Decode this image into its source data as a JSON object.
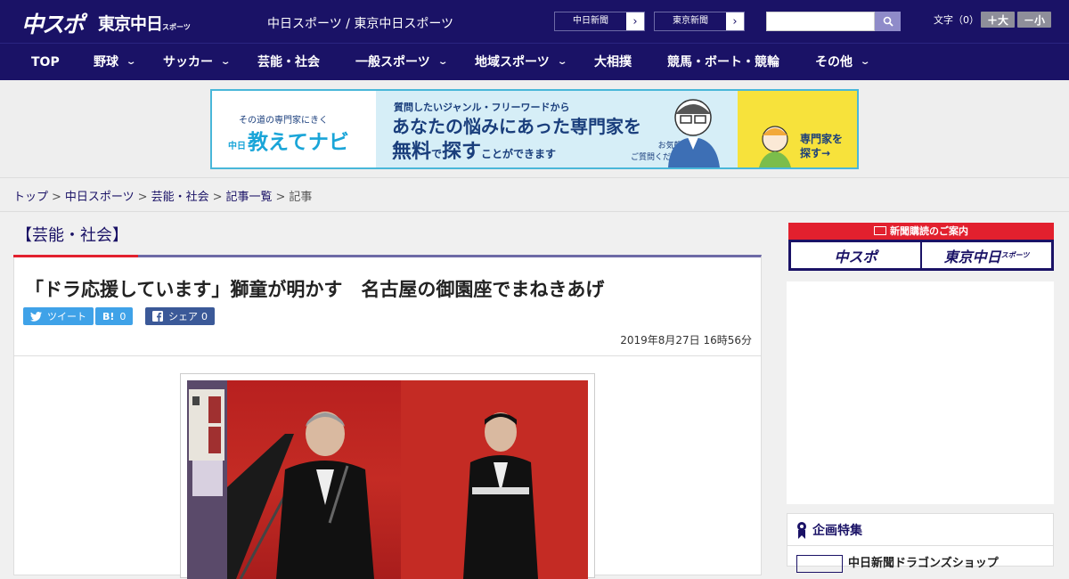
{
  "header": {
    "logo_chuspo": "中スポ",
    "logo_tokyo": "東京中日",
    "logo_tokyo_small": "スポーツ",
    "site_title": "中日スポーツ / 東京中日スポーツ",
    "paper_buttons": [
      "中日新聞",
      "東京新聞"
    ],
    "font_label": "文字（0）",
    "font_bigger": "＋大",
    "font_smaller": "－小",
    "search_placeholder": ""
  },
  "nav": {
    "items": [
      {
        "label": "TOP",
        "has_dropdown": false
      },
      {
        "label": "野球",
        "has_dropdown": true
      },
      {
        "label": "サッカー",
        "has_dropdown": true
      },
      {
        "label": "芸能・社会",
        "has_dropdown": false
      },
      {
        "label": "一般スポーツ",
        "has_dropdown": true
      },
      {
        "label": "地域スポーツ",
        "has_dropdown": true
      },
      {
        "label": "大相撲",
        "has_dropdown": false
      },
      {
        "label": "競馬・ボート・競輪",
        "has_dropdown": false
      },
      {
        "label": "その他",
        "has_dropdown": true
      }
    ]
  },
  "banner": {
    "tagline": "その道の専門家にきく",
    "brand_prefix": "中日",
    "brand": "教えてナビ",
    "line1": "質問したいジャンル・フリーワードから",
    "line2": "あなたの悩みにあった専門家を",
    "line3_a": "無料",
    "line3_b": "で",
    "line3_c": "探す",
    "line3_d": "ことができます",
    "note1": "お気軽に",
    "note2": "ご質問ください!",
    "cta1": "専門家を",
    "cta2": "探す→",
    "colors": {
      "border": "#49b7d9",
      "mid_bg": "#d6eef7",
      "cta_bg": "#f7e23b"
    }
  },
  "breadcrumb": {
    "items": [
      "トップ",
      "中日スポーツ",
      "芸能・社会",
      "記事一覧"
    ],
    "current": "記事",
    "separator": ">"
  },
  "article": {
    "category": "【芸能・社会】",
    "headline": "「ドラ応援しています」獅童が明かす　名古屋の御園座でまねきあげ",
    "share": {
      "tweet_label": "ツイート",
      "hatena_label": "B!",
      "hatena_count": "0",
      "facebook_label": "シェア",
      "facebook_count": "0"
    },
    "date": "2019年8月27日 16時56分"
  },
  "sidebar": {
    "subscribe_head": "新聞購読のご案内",
    "subscribe_buttons": [
      "中スポ",
      "東京中日"
    ],
    "subscribe_small": "スポーツ",
    "feature_title": "企画特集",
    "feature_item": "中日新聞ドラゴンズショップ"
  },
  "colors": {
    "brand_navy": "#1a1266",
    "accent_red": "#e2202e",
    "twitter": "#3fa2e8",
    "facebook": "#3b5998"
  }
}
